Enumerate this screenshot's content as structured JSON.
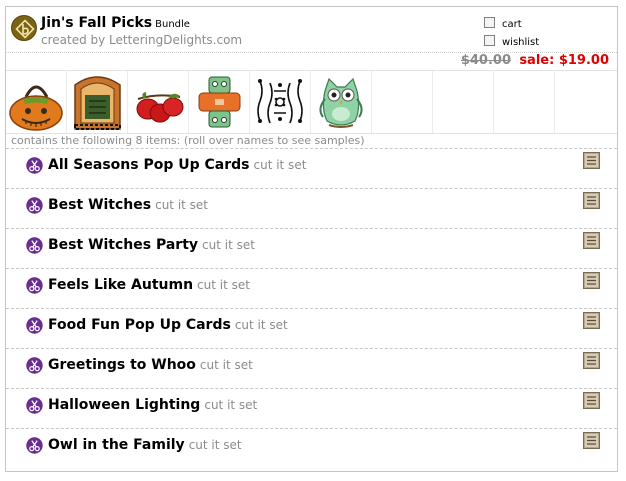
{
  "bundle": {
    "title": "Jin's Fall Picks",
    "kind_label": "Bundle",
    "creator": "created by LetteringDelights.com"
  },
  "options": {
    "cart_label": "cart",
    "wishlist_label": "wishlist"
  },
  "price": {
    "original": "$40.00",
    "sale": "sale: $19.00"
  },
  "colors": {
    "sale": "#e00000",
    "muted": "#8b8b8b",
    "scissor_badge": "#6a2c91",
    "logo": "#7b6316"
  },
  "thumbnails": [
    {
      "icon": "pumpkin-basket-icon"
    },
    {
      "icon": "witch-frame-icon"
    },
    {
      "icon": "apples-icon"
    },
    {
      "icon": "robot-card-icon"
    },
    {
      "icon": "ironwork-pattern-icon"
    },
    {
      "icon": "owl-icon"
    }
  ],
  "contains_text": "contains the following 8 items: (roll over names to see samples)",
  "items": [
    {
      "name": "All Seasons Pop Up Cards",
      "type": "cut it set"
    },
    {
      "name": "Best Witches",
      "type": "cut it set"
    },
    {
      "name": "Best Witches Party",
      "type": "cut it set"
    },
    {
      "name": "Feels Like Autumn",
      "type": "cut it set"
    },
    {
      "name": "Food Fun Pop Up Cards",
      "type": "cut it set"
    },
    {
      "name": "Greetings to Whoo",
      "type": "cut it set"
    },
    {
      "name": "Halloween Lighting",
      "type": "cut it set"
    },
    {
      "name": "Owl in the Family",
      "type": "cut it set"
    }
  ],
  "item_badge": {
    "icon": "tat-tag-icon"
  },
  "item_icon": "scissors-icon"
}
